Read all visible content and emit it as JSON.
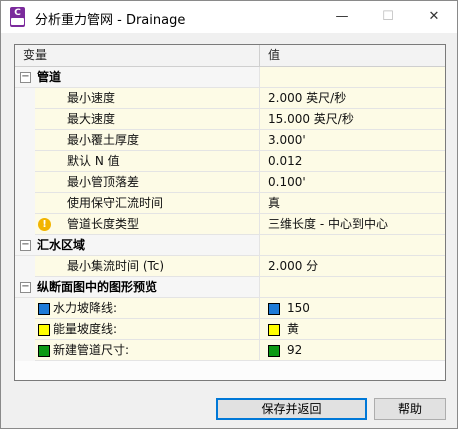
{
  "window": {
    "title": "分析重力管网 - Drainage",
    "app_icon_letter": "C",
    "minimize_glyph": "—",
    "maximize_glyph": "☐",
    "close_glyph": "✕"
  },
  "grid": {
    "columns": {
      "variable": "变量",
      "value": "值"
    },
    "categories": [
      {
        "label": "管道",
        "expander": "−",
        "rows": [
          {
            "name": "最小速度",
            "value": "2.000 英尺/秒"
          },
          {
            "name": "最大速度",
            "value": "15.000 英尺/秒"
          },
          {
            "name": "最小覆土厚度",
            "value": "3.000'"
          },
          {
            "name": "默认 N 值",
            "value": "0.012"
          },
          {
            "name": "最小管顶落差",
            "value": "0.100'"
          },
          {
            "name": "使用保守汇流时间",
            "value": "真"
          },
          {
            "name": "管道长度类型",
            "value": "三维长度 - 中心到中心",
            "warning_icon": "!"
          }
        ]
      },
      {
        "label": "汇水区域",
        "expander": "−",
        "rows": [
          {
            "name": "最小集流时间 (Tc)",
            "value": "2.000 分"
          }
        ]
      },
      {
        "label": "纵断面图中的图形预览",
        "expander": "−",
        "rows": [
          {
            "name": "水力坡降线:",
            "value": "150",
            "color": "#1e7bd7"
          },
          {
            "name": "能量坡度线:",
            "value": "黄",
            "color": "#ffff00"
          },
          {
            "name": "新建管道尺寸:",
            "value": "92",
            "color": "#0c9a14"
          }
        ]
      }
    ]
  },
  "buttons": {
    "save_return": "保存并返回",
    "help": "帮助"
  }
}
